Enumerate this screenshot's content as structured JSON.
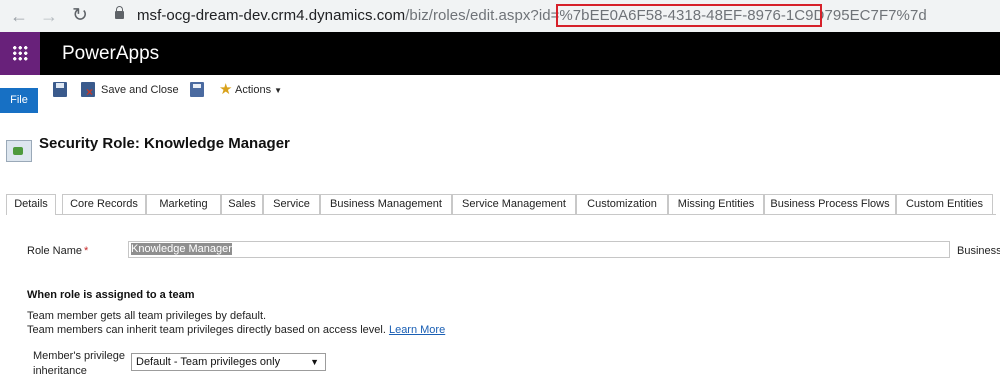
{
  "browser": {
    "back_icon": "←",
    "forward_icon": "→",
    "reload_icon": "↻",
    "url_host": "msf-ocg-dream-dev.crm4.dynamics.com",
    "url_path": "/biz/roles/edit.aspx?id=%7bEE0A6F58-4318-48EF-8976-1C9D795EC7F7%7d"
  },
  "app": {
    "title": "PowerApps"
  },
  "ribbon": {
    "file_label": "File",
    "save_close_label": "Save and Close",
    "actions_label": "Actions"
  },
  "page": {
    "title": "Security Role: Knowledge Manager"
  },
  "tabs": [
    {
      "label": "Details"
    },
    {
      "label": "Core Records"
    },
    {
      "label": "Marketing"
    },
    {
      "label": "Sales"
    },
    {
      "label": "Service"
    },
    {
      "label": "Business Management"
    },
    {
      "label": "Service Management"
    },
    {
      "label": "Customization"
    },
    {
      "label": "Missing Entities"
    },
    {
      "label": "Business Process Flows"
    },
    {
      "label": "Custom Entities"
    }
  ],
  "form": {
    "role_name_label": "Role Name",
    "required_mark": "*",
    "role_name_value": "Knowledge Manager",
    "business_unit_label": "Business",
    "team_section_title": "When role is assigned to a team",
    "desc_line1": "Team member gets all team privileges by default.",
    "desc_line2": "Team members can inherit team privileges directly based on access level.",
    "learn_more": "Learn More",
    "inheritance_label_1": "Member's privilege",
    "inheritance_label_2": "inheritance",
    "inheritance_value": "Default - Team privileges only"
  }
}
